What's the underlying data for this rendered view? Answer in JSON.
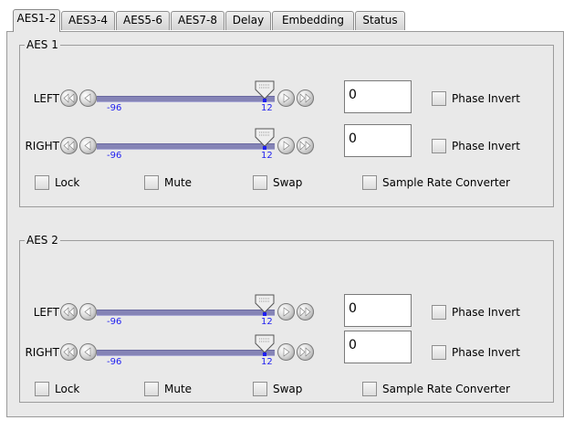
{
  "tabs": [
    {
      "label": "AES1-2",
      "active": true
    },
    {
      "label": "AES3-4",
      "active": false
    },
    {
      "label": "AES5-6",
      "active": false
    },
    {
      "label": "AES7-8",
      "active": false
    },
    {
      "label": "Delay",
      "active": false
    },
    {
      "label": "Embedding",
      "active": false
    },
    {
      "label": "Status",
      "active": false
    }
  ],
  "groups": [
    {
      "title": "AES 1",
      "channels": [
        {
          "label": "LEFT",
          "min": "-96",
          "max": "12",
          "value": "0",
          "level_fraction": 0.0,
          "phase_label": "Phase Invert",
          "phase_checked": false
        },
        {
          "label": "RIGHT",
          "min": "-96",
          "max": "12",
          "value": "0",
          "level_fraction": 0.0,
          "phase_label": "Phase Invert",
          "phase_checked": false
        }
      ],
      "options": [
        {
          "label": "Lock",
          "checked": false
        },
        {
          "label": "Mute",
          "checked": false
        },
        {
          "label": "Swap",
          "checked": false
        },
        {
          "label": "Sample Rate Converter",
          "checked": false
        }
      ]
    },
    {
      "title": "AES 2",
      "channels": [
        {
          "label": "LEFT",
          "min": "-96",
          "max": "12",
          "value": "0",
          "level_fraction": 0.0,
          "phase_label": "Phase Invert",
          "phase_checked": false
        },
        {
          "label": "RIGHT",
          "min": "-96",
          "max": "12",
          "value": "0",
          "level_fraction": 0.0,
          "phase_label": "Phase Invert",
          "phase_checked": false
        }
      ],
      "options": [
        {
          "label": "Lock",
          "checked": false
        },
        {
          "label": "Mute",
          "checked": false
        },
        {
          "label": "Swap",
          "checked": false
        },
        {
          "label": "Sample Rate Converter",
          "checked": false
        }
      ]
    }
  ],
  "colors": {
    "panel": "#e9e9e9",
    "track": "#8584b6",
    "scale_text": "#1f1ff0"
  },
  "icons": {
    "fast_backward": "double-left-arrow-icon",
    "step_backward": "left-arrow-icon",
    "step_forward": "right-arrow-icon",
    "fast_forward": "double-right-arrow-icon",
    "slider_thumb": "slider-thumb-icon"
  }
}
